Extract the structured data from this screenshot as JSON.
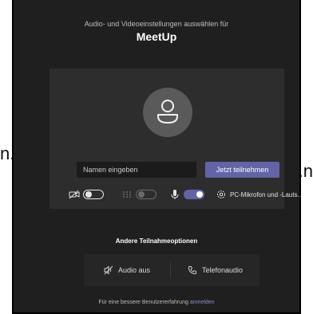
{
  "header": {
    "subtitle": "Audio- und Videoeinstellungen auswählen für",
    "title": "MeetUp"
  },
  "join": {
    "name_placeholder": "Namen eingeben",
    "join_label": "Jetzt teilnehmen"
  },
  "devices": {
    "video": {
      "state": "off"
    },
    "blur": {
      "state": "disabled"
    },
    "mic": {
      "state": "on"
    },
    "device_label": "PC-Mikrofon und -Lauts..."
  },
  "other": {
    "title": "Andere Teilnahmeoptionen",
    "audio_off": "Audio aus",
    "phone_audio": "Telefonaudio"
  },
  "footer": {
    "text": "Für eine bessere Benutzererfahrung",
    "link": "anmelden"
  },
  "outside": {
    "left_fragment": "n.",
    "right_fragment": "n."
  },
  "colors": {
    "background": "#1f1f1f",
    "card": "#2d2d2d",
    "accent": "#6264a7",
    "link": "#8b8cd6"
  }
}
